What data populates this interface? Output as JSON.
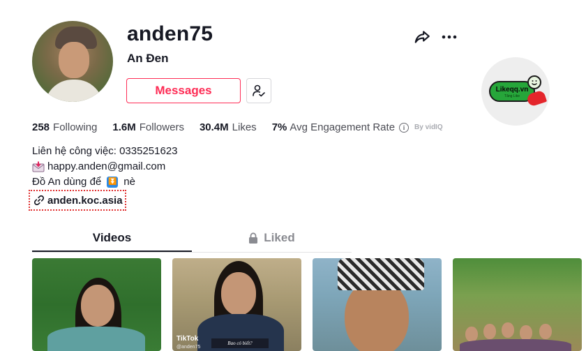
{
  "profile": {
    "username": "anden75",
    "nickname": "An Đen",
    "messages_label": "Messages"
  },
  "badge": {
    "text": "Likeqq.vn",
    "subtext": "Tăng Like"
  },
  "stats": {
    "following_count": "258",
    "following_label": "Following",
    "followers_count": "1.6M",
    "followers_label": "Followers",
    "likes_count": "30.4M",
    "likes_label": "Likes",
    "engagement_value": "7%",
    "engagement_label": "Avg Engagement Rate",
    "byline": "By vidIQ"
  },
  "bio": {
    "line1": "Liên hệ công việc: 0335251623",
    "line2": "happy.anden@gmail.com",
    "line3_a": "Đồ An dùng để",
    "line3_b": "nè"
  },
  "link": {
    "text": "anden.koc.asia"
  },
  "tabs": [
    {
      "label": "Videos",
      "active": true
    },
    {
      "label": "Liked",
      "active": false
    }
  ],
  "thumbnails": [
    {
      "overlay": ""
    },
    {
      "tiktok_label": "TikTok",
      "tiktok_user": "@anden75",
      "caption": "Bao có biết?"
    },
    {
      "overlay": ""
    },
    {
      "overlay": ""
    }
  ],
  "colors": {
    "accent": "#fe2c55",
    "text": "#161823",
    "muted": "#4b4c54",
    "link_outline": "#e03030"
  },
  "icons": {
    "share": "share-arrow-icon",
    "more": "more-dots-icon",
    "follow": "person-check-icon",
    "info": "info-icon",
    "mail": "envelope-download-icon",
    "download": "down-arrow-emoji-icon",
    "link": "chain-link-icon",
    "lock": "lock-icon"
  }
}
